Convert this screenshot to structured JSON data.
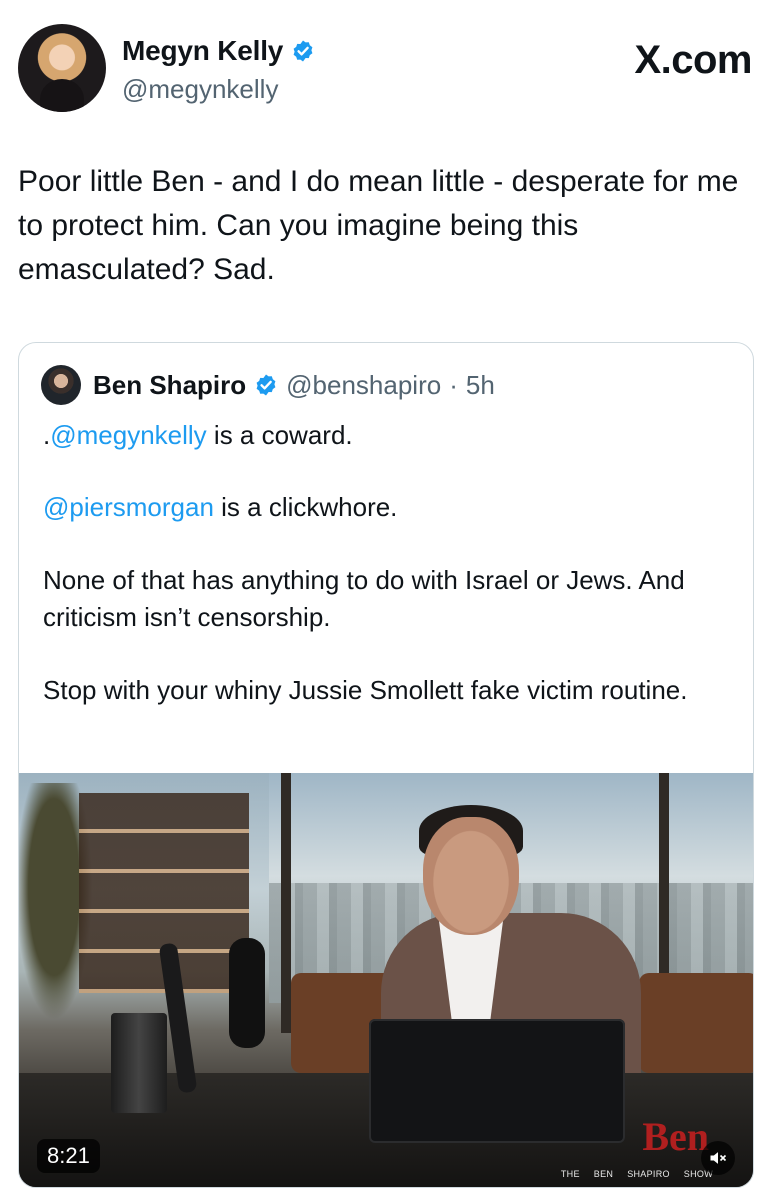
{
  "header": {
    "display_name": "Megyn Kelly",
    "handle": "@megynkelly",
    "site": "X.com"
  },
  "tweet": {
    "text": "Poor little Ben - and I do mean little - desperate for me to protect him. Can you imagine being this emasculated? Sad."
  },
  "quoted": {
    "display_name": "Ben Shapiro",
    "handle": "@benshapiro",
    "separator": "·",
    "time": "5h",
    "line1_prefix": ".",
    "line1_mention": "@megynkelly",
    "line1_rest": " is a coward.",
    "line2_mention": "@piersmorgan",
    "line2_rest": " is a clickwhore.",
    "para3": "None of that has anything to do with Israel or Jews. And criticism isn’t censorship.",
    "para4": "Stop with your whiny Jussie Smollett fake victim routine."
  },
  "video": {
    "duration": "8:21",
    "logo_text": "Ben",
    "footer_words": [
      "THE",
      "BEN",
      "SHAPIRO",
      "SHOW"
    ],
    "mute_icon": "muted-speaker-icon"
  },
  "colors": {
    "verified": "#1d9bf0",
    "mention": "#1d9bf0",
    "secondary_text": "#536471"
  }
}
